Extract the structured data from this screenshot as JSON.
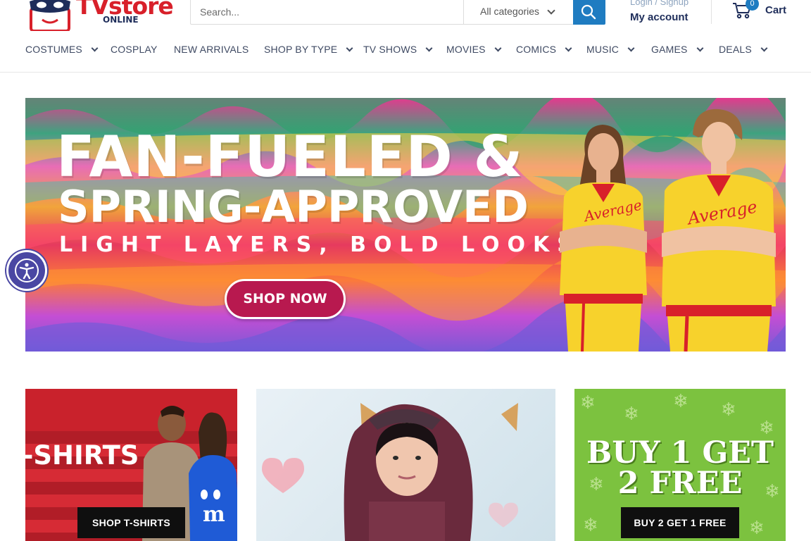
{
  "brand": {
    "name": "TVstore",
    "sub": "ONLINE"
  },
  "search": {
    "placeholder": "Search...",
    "category": "All categories"
  },
  "account": {
    "login": "Login / Signup",
    "label": "My account"
  },
  "cart": {
    "count": "0",
    "label": "Cart"
  },
  "nav": {
    "items": [
      {
        "label": "COSTUMES",
        "dropdown": true
      },
      {
        "label": "COSPLAY",
        "dropdown": false
      },
      {
        "label": "NEW ARRIVALS",
        "dropdown": false
      },
      {
        "label": "SHOP BY TYPE",
        "dropdown": true
      },
      {
        "label": "TV SHOWS",
        "dropdown": true
      },
      {
        "label": "MOVIES",
        "dropdown": true
      },
      {
        "label": "COMICS",
        "dropdown": true
      },
      {
        "label": "MUSIC",
        "dropdown": true
      },
      {
        "label": "GAMES",
        "dropdown": true
      },
      {
        "label": "DEALS",
        "dropdown": true
      }
    ]
  },
  "hero": {
    "line1": "FAN-FUELED &",
    "line2": "SPRING-APPROVED",
    "line3": "LIGHT LAYERS, BOLD LOOKS",
    "cta": "SHOP NOW"
  },
  "promos": {
    "tshirts": {
      "title": "-SHIRTS",
      "cta": "SHOP T-SHIRTS"
    },
    "deal": {
      "title_line1": "BUY 1 GET",
      "title_line2": "2 FREE",
      "cta": "BUY 2 GET 1 FREE"
    }
  },
  "colors": {
    "brand_red": "#d8202a",
    "navy": "#1e2d5a",
    "accent_blue": "#1f7cc1",
    "cta_pink": "#b8194f",
    "deal_green": "#7cc23f",
    "a11y_purple": "#4a47a3"
  },
  "icons": {
    "logo": "mask-tv-logo-icon",
    "search": "search-icon",
    "cart": "cart-icon",
    "accessibility": "accessibility-icon"
  }
}
